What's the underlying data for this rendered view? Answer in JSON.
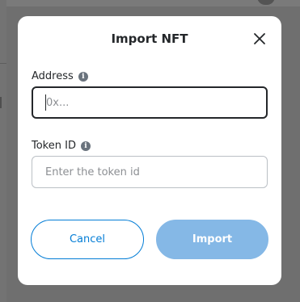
{
  "modal": {
    "title": "Import NFT",
    "close_icon": "close-icon"
  },
  "address": {
    "label": "Address",
    "info_icon": "info-icon",
    "value": "",
    "placeholder": "0x..."
  },
  "token_id": {
    "label": "Token ID",
    "info_icon": "info-icon",
    "value": "",
    "placeholder": "Enter the token id"
  },
  "actions": {
    "cancel_label": "Cancel",
    "import_label": "Import"
  },
  "colors": {
    "primary": "#037dd6",
    "primary_disabled": "#85b8e6",
    "text": "#24272a",
    "border": "#bbc0c5",
    "backdrop": "#6f6f6f"
  }
}
